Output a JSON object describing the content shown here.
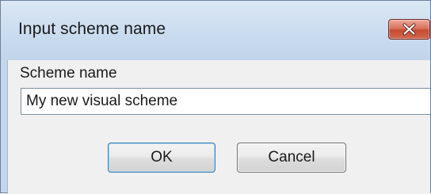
{
  "window": {
    "title": "Input scheme name"
  },
  "titlebar_buttons": {
    "close_icon": "close-icon"
  },
  "form": {
    "field_label": "Scheme name",
    "field_value": "My new visual scheme"
  },
  "buttons": {
    "ok_label": "OK",
    "cancel_label": "Cancel"
  },
  "colors": {
    "titlebar": "#cadcef",
    "close_button": "#c74a32",
    "dialog_background": "#f0f0f0",
    "default_button_border": "#3c7fb1"
  }
}
